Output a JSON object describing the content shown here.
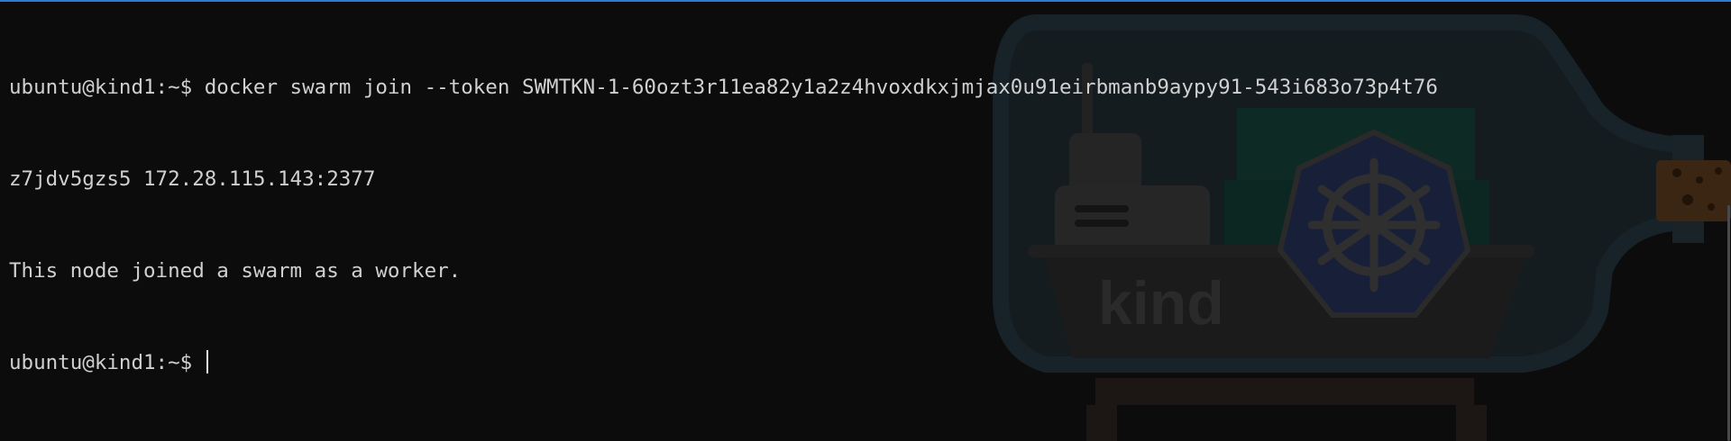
{
  "terminal": {
    "lines": [
      "ubuntu@kind1:~$ docker swarm join --token SWMTKN-1-60ozt3r11ea82y1a2z4hvoxdkxjmjax0u91eirbmanb9aypy91-543i683o73p4t76",
      "z7jdv5gzs5 172.28.115.143:2377",
      "This node joined a swarm as a worker."
    ],
    "prompt": "ubuntu@kind1:~$ ",
    "text_color": "#d0d0d0",
    "background_color": "#0c0c0c",
    "accent_color": "#2f78d6"
  },
  "background_image": {
    "logo_text": "kind",
    "icons": [
      "bottle-icon",
      "ship-icon",
      "kubernetes-helm-icon",
      "cork-icon"
    ]
  }
}
